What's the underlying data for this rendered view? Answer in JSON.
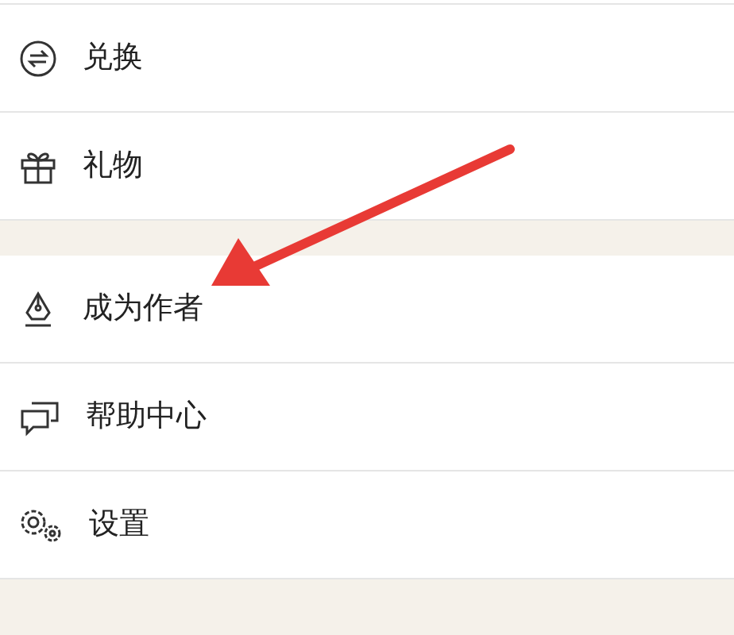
{
  "sections": [
    {
      "items": [
        {
          "label": "兑换",
          "kind": "exchange"
        },
        {
          "label": "礼物",
          "kind": "gift"
        }
      ]
    },
    {
      "items": [
        {
          "label": "成为作者",
          "kind": "pen"
        },
        {
          "label": "帮助中心",
          "kind": "chat"
        },
        {
          "label": "设置",
          "kind": "gears"
        }
      ]
    }
  ]
}
